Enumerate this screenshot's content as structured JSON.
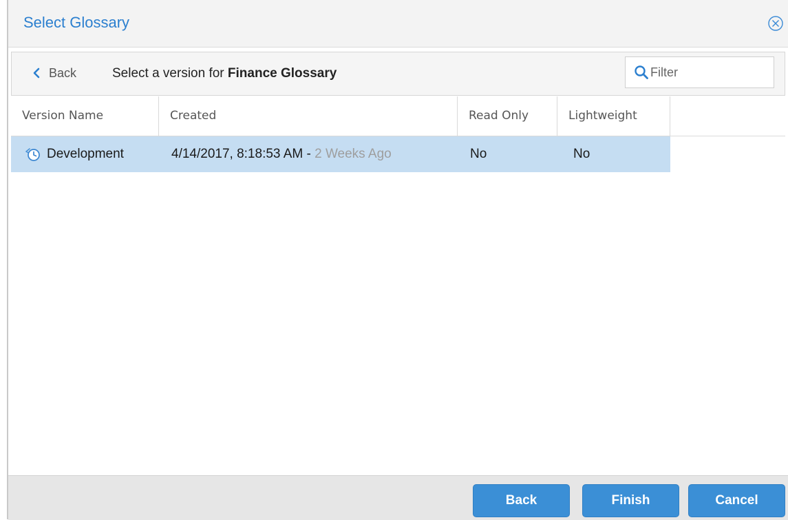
{
  "dialog": {
    "title": "Select Glossary",
    "close_icon": "close-circle-icon"
  },
  "subbar": {
    "back_label": "Back",
    "title_prefix": "Select a version for ",
    "title_glossary": "Finance Glossary",
    "filter_placeholder": "Filter",
    "filter_value": ""
  },
  "table": {
    "columns": [
      "Version Name",
      "Created",
      "Read Only",
      "Lightweight"
    ],
    "rows": [
      {
        "icon": "version-clock-icon",
        "name": "Development",
        "created": "4/14/2017, 8:18:53 AM - ",
        "created_relative": "2 Weeks Ago",
        "read_only": "No",
        "lightweight": "No",
        "selected": true
      }
    ]
  },
  "footer": {
    "back_label": "Back",
    "finish_label": "Finish",
    "cancel_label": "Cancel"
  },
  "colors": {
    "accent": "#2b7fcf",
    "button": "#3b8fd6",
    "selected_row": "#c5ddf2"
  }
}
